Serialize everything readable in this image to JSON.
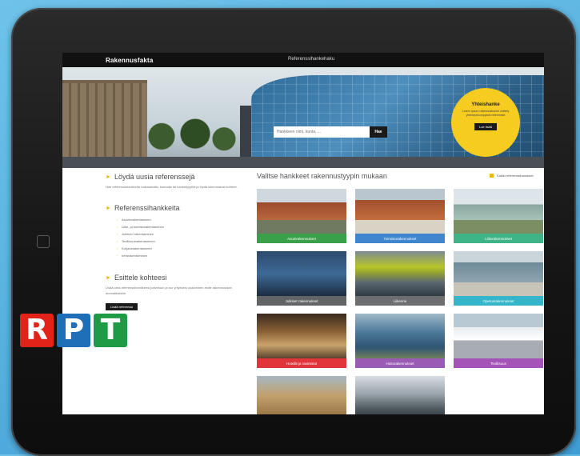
{
  "site": {
    "logo": "Rakennusfakta",
    "top_link": "Referenssihanke­haku"
  },
  "hero": {
    "search_placeholder": "Hankkeen nimi, kunta, ...",
    "search_button": "Hae",
    "promo": {
      "title": "Yhteishanke",
      "text": "Lorem ipsum rakennushanke esittely yhteistyökumppanit referenssit",
      "button": "Lue lisää"
    }
  },
  "left": {
    "section1_title": "Löydä uusia referenssejä",
    "section1_text": "Hae referenssihankkeita hakusanalla, kunnalla tai hanketyypillä ja löydä kiinnostavat kohteet.",
    "section2_title": "Referenssihankkeita",
    "section2_items": [
      "Asuntorakentaminen",
      "Liike- ja toimistorakentaminen",
      "Julkinen rakentaminen",
      "Teollisuusrakentaminen",
      "Korjausrakentaminen",
      "Infrarakentaminen"
    ],
    "section3_title": "Esittele kohteesi",
    "section3_text": "Lisää oma referenssihankkeesi palveluun ja tuo yrityksesi osaaminen esille rakennusalan ammattilaisille.",
    "section3_button": "Lisää referenssi"
  },
  "rpt_logo": {
    "letters": [
      "R",
      "P",
      "T"
    ],
    "colors": [
      "#e2231a",
      "#1e6fb8",
      "#1f9b45"
    ]
  },
  "grid": {
    "title": "Valitse hankkeet rakennustyypin mukaan",
    "link": "Kaikki referenssihankkeet",
    "cards": [
      {
        "label": "Asuinrakennukset",
        "color": "#3aa04a"
      },
      {
        "label": "Toimistorakennukset",
        "color": "#3f86cf"
      },
      {
        "label": "Liikerakennukset",
        "color": "#3fb489"
      },
      {
        "label": "Julkiset rakennukset",
        "color": "#636466"
      },
      {
        "label": "Liikenne",
        "color": "#6d6e70"
      },
      {
        "label": "Opetusrakennukset",
        "color": "#34b5c9"
      },
      {
        "label": "Hotellit ja ravintolat",
        "color": "#e0353b"
      },
      {
        "label": "Hoitorakennukset",
        "color": "#9b5bb5"
      },
      {
        "label": "Teollisuus",
        "color": "#a453b6"
      },
      {
        "label": "",
        "color": "#666666"
      },
      {
        "label": "",
        "color": "#666666"
      }
    ]
  }
}
